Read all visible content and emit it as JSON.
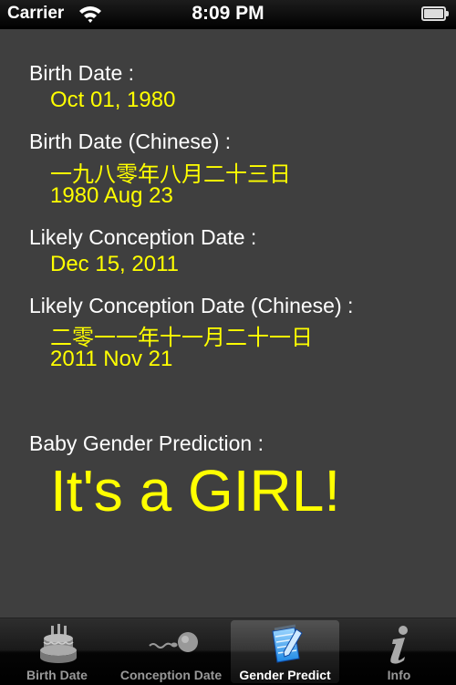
{
  "status_bar": {
    "carrier": "Carrier",
    "time": "8:09 PM",
    "icons": [
      "wifi-icon",
      "battery-icon"
    ]
  },
  "main": {
    "birth_date_label": "Birth Date :",
    "birth_date_value": "Oct 01, 1980",
    "birth_date_chinese_label": "Birth Date (Chinese) :",
    "birth_date_chinese_value": "一九八零年八月二十三日",
    "birth_date_chinese_value2": "1980 Aug 23",
    "conception_label": "Likely Conception Date :",
    "conception_value": "Dec 15, 2011",
    "conception_chinese_label": "Likely Conception Date (Chinese) :",
    "conception_chinese_value": "二零一一年十一月二十一日",
    "conception_chinese_value2": "2011 Nov 21",
    "prediction_label": "Baby Gender Prediction :",
    "prediction_result": "It's a GIRL!"
  },
  "colors": {
    "background": "#3f3f3f",
    "label_text": "#ffffff",
    "value_text": "#ffff00"
  },
  "tab_bar": {
    "selected_index": 2,
    "tabs": [
      {
        "label": "Birth Date",
        "icon": "birthday-cake-icon"
      },
      {
        "label": "Conception Date",
        "icon": "sperm-egg-icon"
      },
      {
        "label": "Gender Predict",
        "icon": "notepad-pencil-icon"
      },
      {
        "label": "Info",
        "icon": "info-icon"
      }
    ]
  }
}
